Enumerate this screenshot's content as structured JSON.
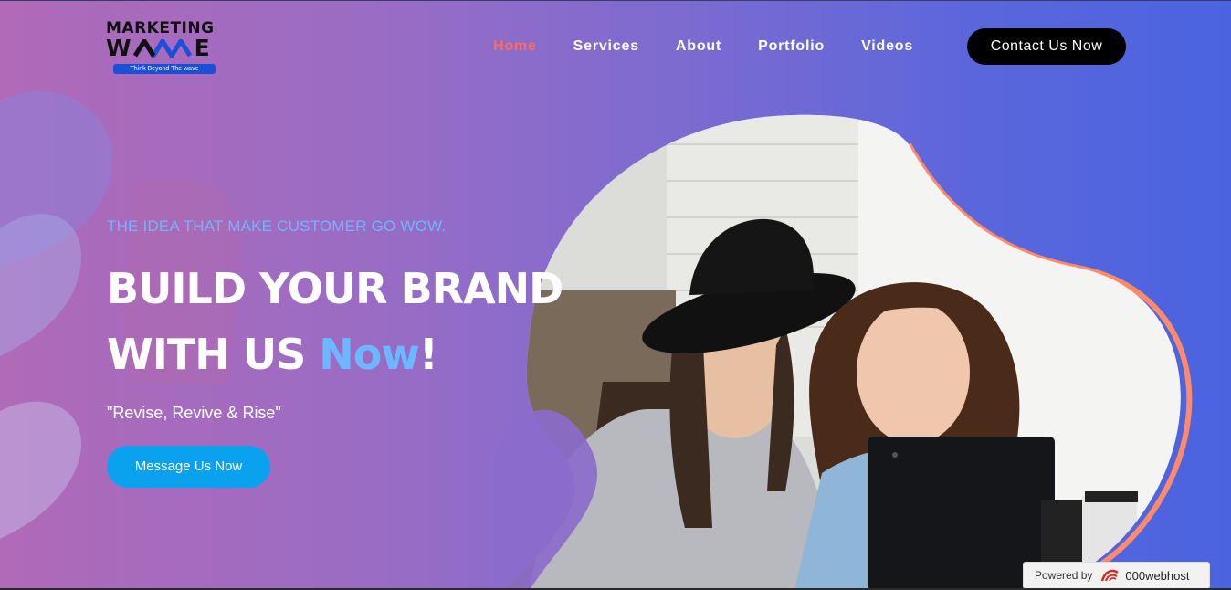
{
  "logo": {
    "line1": "MARKETING",
    "line2_start": "W",
    "line2_end": "E",
    "tagline": "Think Beyond The wave"
  },
  "nav": {
    "items": [
      {
        "label": "Home",
        "active": true
      },
      {
        "label": "Services",
        "active": false
      },
      {
        "label": "About",
        "active": false
      },
      {
        "label": "Portfolio",
        "active": false
      },
      {
        "label": "Videos",
        "active": false
      }
    ],
    "cta_label": "Contact Us Now"
  },
  "hero": {
    "eyebrow": "THE IDEA THAT MAKE CUSTOMER GO WOW.",
    "headline_line1": "BUILD YOUR BRAND",
    "headline_line2_start": "WITH US ",
    "headline_accent": "Now",
    "headline_end": "!",
    "quote": "\"Revise, Revive & Rise\"",
    "button_label": "Message Us Now"
  },
  "footer_badge": {
    "label": "Powered by",
    "brand": "000webhost"
  },
  "colors": {
    "accent_blue": "#6cb8ff",
    "active_nav": "#ff6b5a",
    "cta_black": "#000000",
    "button_blue": "#0aa2ef",
    "blob_border": "#ff8a6a"
  }
}
